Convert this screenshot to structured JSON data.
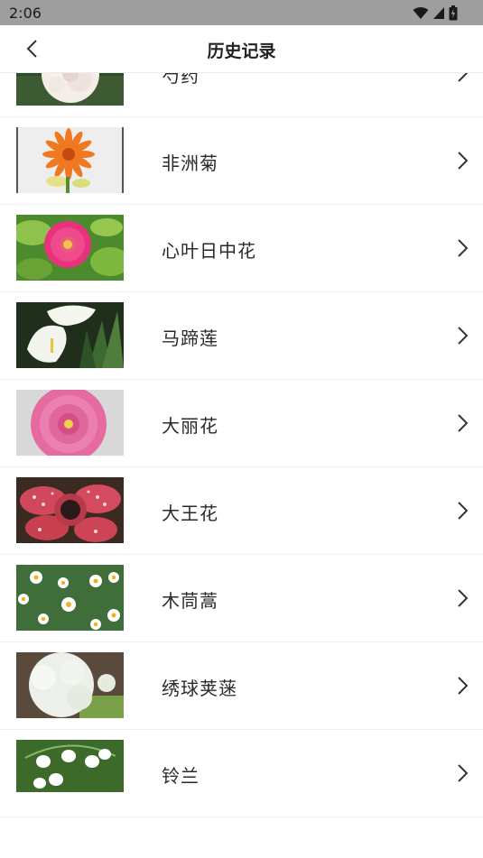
{
  "status": {
    "time": "2:06"
  },
  "header": {
    "title": "历史记录"
  },
  "items": [
    {
      "label": "芍药"
    },
    {
      "label": "非洲菊"
    },
    {
      "label": "心叶日中花"
    },
    {
      "label": "马蹄莲"
    },
    {
      "label": "大丽花"
    },
    {
      "label": "大王花"
    },
    {
      "label": "木茼蒿"
    },
    {
      "label": "绣球荚蒾"
    },
    {
      "label": "铃兰"
    }
  ]
}
